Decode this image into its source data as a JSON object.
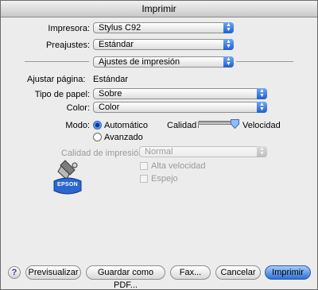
{
  "window": {
    "title": "Imprimir"
  },
  "printer": {
    "label": "Impresora:",
    "value": "Stylus C92"
  },
  "presets": {
    "label": "Preajustes:",
    "value": "Estándar"
  },
  "panel": {
    "value": "Ajustes de impresión"
  },
  "page_size": {
    "label": "Ajustar página:",
    "value": "Estándar"
  },
  "paper_type": {
    "label": "Tipo de papel:",
    "value": "Sobre"
  },
  "color": {
    "label": "Color:",
    "value": "Color"
  },
  "mode": {
    "label": "Modo:",
    "automatic_label": "Automático",
    "advanced_label": "Avanzado",
    "selected": "Automático"
  },
  "quality_slider": {
    "left_label": "Calidad",
    "right_label": "Velocidad",
    "position": 1.0
  },
  "print_quality": {
    "label": "Calidad de impresión:",
    "value": "Normal"
  },
  "high_speed": {
    "label": "Alta velocidad",
    "checked": false
  },
  "mirror": {
    "label": "Espejo",
    "checked": false
  },
  "logo": {
    "text": "EPSON"
  },
  "buttons": {
    "help": "?",
    "preview": "Previsualizar",
    "save_pdf": "Guardar como PDF...",
    "fax": "Fax...",
    "cancel": "Cancelar",
    "print": "Imprimir"
  },
  "icons": {
    "popup_arrows": "▲▼"
  }
}
